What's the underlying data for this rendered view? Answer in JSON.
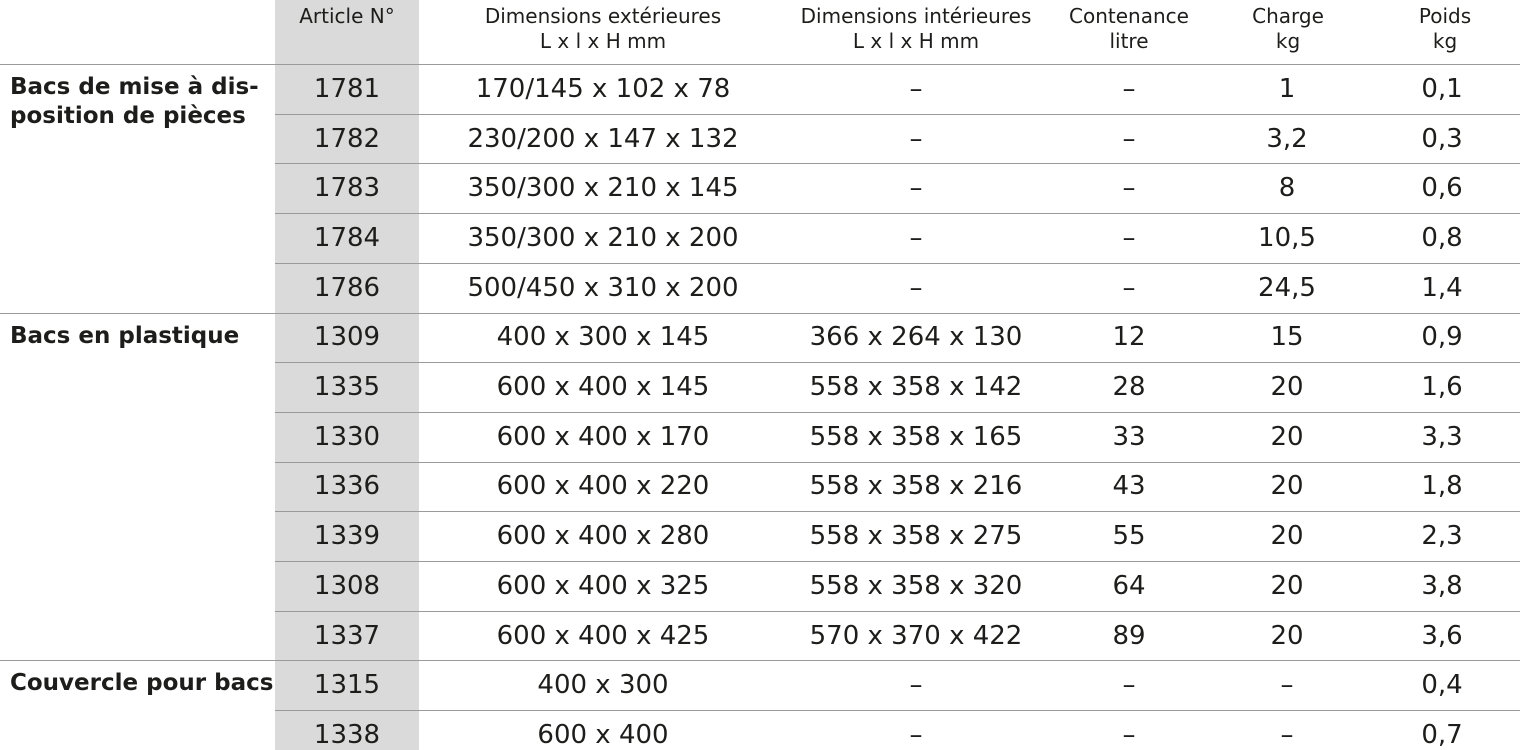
{
  "headers": {
    "article": [
      "Article N°"
    ],
    "ext": [
      "Dimensions extérieures",
      "L x l x H mm"
    ],
    "int": [
      "Dimensions intérieures",
      "L x l x H mm"
    ],
    "cont": [
      "Contenance",
      "litre"
    ],
    "charge": [
      "Charge",
      "kg"
    ],
    "poids": [
      "Poids",
      "kg"
    ]
  },
  "groups": [
    {
      "lines": [
        "Bacs de mise à dis-",
        "position de pièces"
      ],
      "rows": [
        {
          "article": "1781",
          "ext": "170/145 x 102 x 78",
          "int": "–",
          "cont": "–",
          "charge": "1",
          "poids": "0,1"
        },
        {
          "article": "1782",
          "ext": "230/200 x 147 x 132",
          "int": "–",
          "cont": "–",
          "charge": "3,2",
          "poids": "0,3"
        },
        {
          "article": "1783",
          "ext": "350/300 x 210 x 145",
          "int": "–",
          "cont": "–",
          "charge": "8",
          "poids": "0,6"
        },
        {
          "article": "1784",
          "ext": "350/300 x 210 x 200",
          "int": "–",
          "cont": "–",
          "charge": "10,5",
          "poids": "0,8"
        },
        {
          "article": "1786",
          "ext": "500/450 x 310 x 200",
          "int": "–",
          "cont": "–",
          "charge": "24,5",
          "poids": "1,4"
        }
      ]
    },
    {
      "lines": [
        "Bacs en plastique"
      ],
      "rows": [
        {
          "article": "1309",
          "ext": "400 x 300 x 145",
          "int": "366 x 264 x 130",
          "cont": "12",
          "charge": "15",
          "poids": "0,9"
        },
        {
          "article": "1335",
          "ext": "600 x 400 x 145",
          "int": "558 x 358 x 142",
          "cont": "28",
          "charge": "20",
          "poids": "1,6"
        },
        {
          "article": "1330",
          "ext": "600 x 400 x 170",
          "int": "558 x 358 x 165",
          "cont": "33",
          "charge": "20",
          "poids": "3,3"
        },
        {
          "article": "1336",
          "ext": "600 x 400 x 220",
          "int": "558 x 358 x 216",
          "cont": "43",
          "charge": "20",
          "poids": "1,8"
        },
        {
          "article": "1339",
          "ext": "600 x 400 x 280",
          "int": "558 x 358 x 275",
          "cont": "55",
          "charge": "20",
          "poids": "2,3"
        },
        {
          "article": "1308",
          "ext": "600 x 400 x 325",
          "int": "558 x 358 x 320",
          "cont": "64",
          "charge": "20",
          "poids": "3,8"
        },
        {
          "article": "1337",
          "ext": "600 x 400 x 425",
          "int": "570 x 370 x 422",
          "cont": "89",
          "charge": "20",
          "poids": "3,6"
        }
      ]
    },
    {
      "lines": [
        "Couvercle pour bacs"
      ],
      "rows": [
        {
          "article": "1315",
          "ext": "400 x 300",
          "int": "–",
          "cont": "–",
          "charge": "–",
          "poids": "0,4"
        },
        {
          "article": "1338",
          "ext": "600 x 400",
          "int": "–",
          "cont": "–",
          "charge": "–",
          "poids": "0,7"
        }
      ]
    }
  ]
}
